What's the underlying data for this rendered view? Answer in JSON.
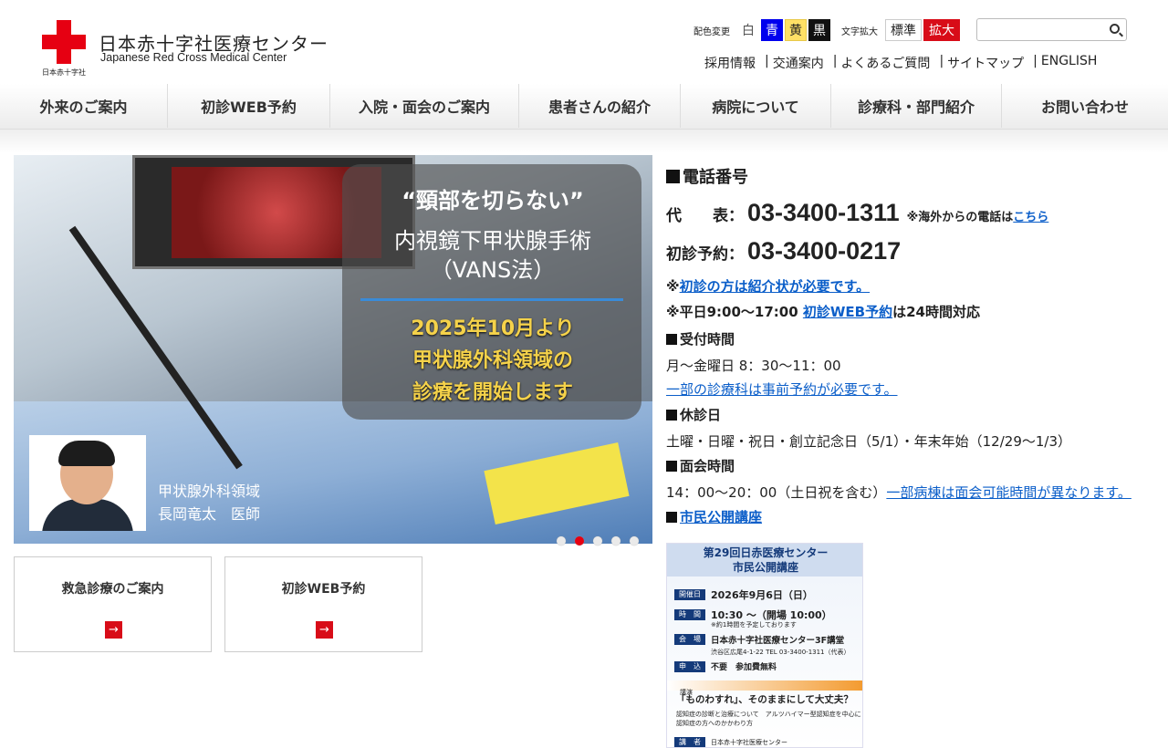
{
  "header": {
    "logo_jp": "日本赤十字社医療センター",
    "logo_en": "Japanese Red Cross Medical Center",
    "logo_small": "日本赤十字社",
    "color_change_label": "配色変更",
    "colors": [
      {
        "label": "白",
        "hex": "#ffffff"
      },
      {
        "label": "青",
        "hex": "#0000ee"
      },
      {
        "label": "黄",
        "hex": "#ffe066"
      },
      {
        "label": "黒",
        "hex": "#111111"
      }
    ],
    "font_size_label": "文字拡大",
    "font_standard": "標準",
    "font_large": "拡大",
    "search_value": "",
    "sublinks": [
      "採用情報",
      "交通案内",
      "よくあるご質問",
      "サイトマップ",
      "ENGLISH"
    ]
  },
  "nav": [
    "外来のご案内",
    "初診WEB予約",
    "入院・面会のご案内",
    "患者さんの紹介",
    "病院について",
    "診療科・部門紹介",
    "お問い合わせ"
  ],
  "hero": {
    "quote": "“頸部を切らない”",
    "sub1": "内視鏡下甲状腺手術",
    "sub2": "（VANS法）",
    "gold1": "2025年10月より",
    "gold2": "甲状腺外科領域の",
    "gold3": "診療を開始します",
    "caption1": "甲状腺外科領域",
    "caption2": "長岡竜太　医師",
    "slides": 5,
    "active_slide": 2
  },
  "tiles": [
    "救急診療のご案内",
    "初診WEB予約"
  ],
  "info": {
    "tel_heading": "電話番号",
    "main_label": "代　　表：",
    "main_number": "03-3400-1311",
    "overseas_note": "※海外からの電話は",
    "overseas_link": "こちら",
    "first_label": "初診予約：",
    "first_number": "03-3400-0217",
    "note1_prefix": "※",
    "note1_link": "初診の方は紹介状が必要です。",
    "note2_prefix": "※平日9:00〜17:00 ",
    "note2_link": "初診WEB予約",
    "note2_suffix": "は24時間対応",
    "reception_heading": "受付時間",
    "reception_hours": "月〜金曜日 8：30〜11：00",
    "reception_link": "一部の診療科は事前予約が必要です。",
    "closed_heading": "休診日",
    "closed_days": "土曜・日曜・祝日・創立記念日（5/1）・年末年始（12/29〜1/3）",
    "visit_heading": "面会時間",
    "visit_hours": "14：00〜20：00（土日祝を含む）",
    "visit_link": "一部病棟は面会可能時間が異なります。",
    "lecture_link": "市民公開講座"
  },
  "poster": {
    "title1": "第29回日赤医療センター",
    "title2": "市民公開講座",
    "date_tag": "開催日",
    "date": "2026年9月6日（日）",
    "time_tag": "時　間",
    "time": "10:30 〜（開場 10:00）",
    "time_note": "※約1時間を予定しております",
    "venue_tag": "会　場",
    "venue": "日本赤十字社医療センター3F講堂",
    "address": "渋谷区広尾4-1-22  TEL 03-3400-1311（代表）",
    "apply_tag": "申　込",
    "apply": "不要　参加費無料",
    "theme_tag": "講演",
    "theme": "「ものわすれ」、そのままにして大丈夫？",
    "desc1": "認知症の診断と治療について　アルツハイマー型認知症を中心に",
    "desc2": "認知症の方へのかかわり方",
    "speaker_tag": "講　者",
    "speaker": "日本赤十字社医療センター"
  }
}
